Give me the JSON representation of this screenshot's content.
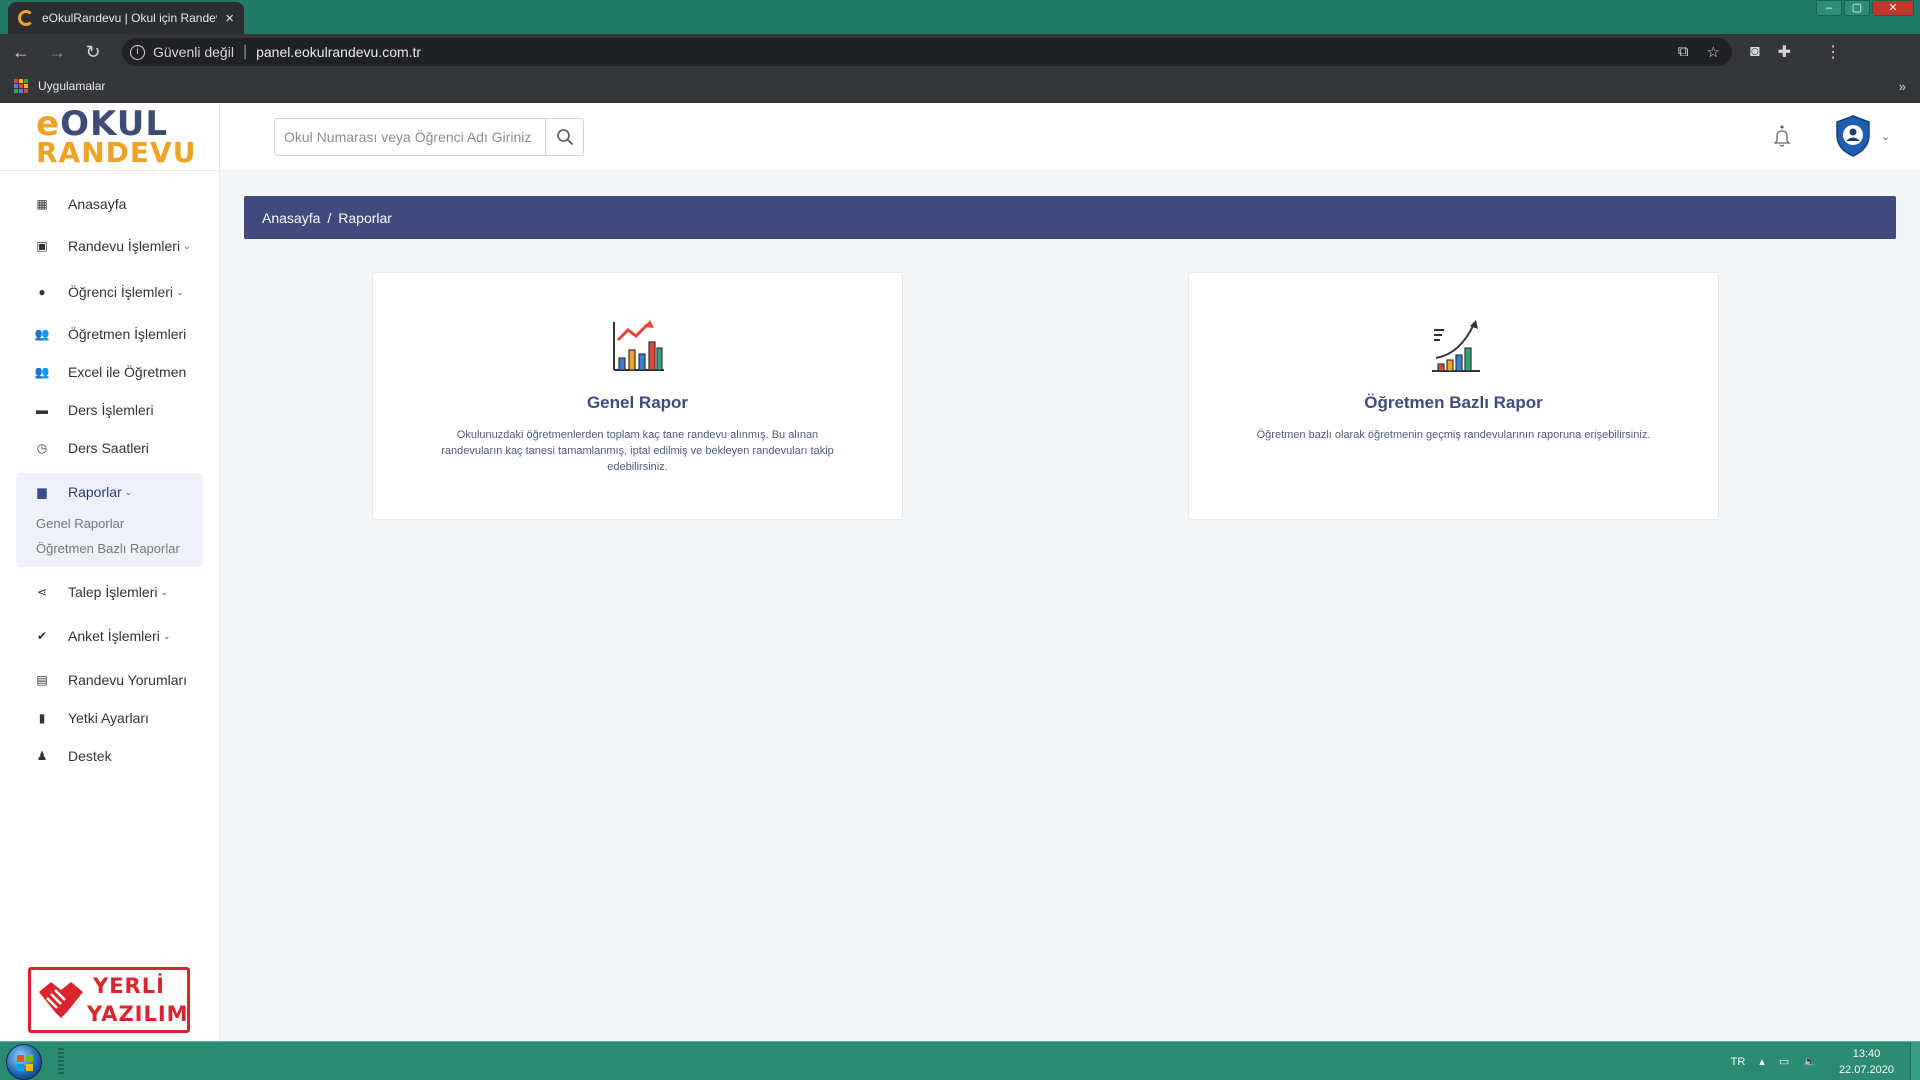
{
  "browser": {
    "tab_title": "eOkulRandevu | Okul için Randevu",
    "security_label": "Güvenli değil",
    "url": "panel.eokulrandevu.com.tr",
    "bookmarks_label": "Uygulamalar",
    "bookmarks_more": "»"
  },
  "logo": {
    "line1_accent": "e",
    "line1": "OKUL",
    "line2": "RANDEVU"
  },
  "search": {
    "placeholder": "Okul Numarası veya Öğrenci Adı Giriniz"
  },
  "sidebar": {
    "items": [
      {
        "label": "Anasayfa",
        "icon": "dashboard-icon"
      },
      {
        "label": "Randevu İşlemleri",
        "icon": "calendar-icon",
        "chevron": true
      },
      {
        "label": "Öğrenci İşlemleri",
        "icon": "user-icon",
        "chevron": true
      },
      {
        "label": "Öğretmen İşlemleri",
        "icon": "users-icon"
      },
      {
        "label": "Excel ile Öğretmen",
        "icon": "users-icon"
      },
      {
        "label": "Ders İşlemleri",
        "icon": "folder-icon"
      },
      {
        "label": "Ders Saatleri",
        "icon": "clock-icon"
      },
      {
        "label": "Raporlar",
        "icon": "bar-chart-icon",
        "chevron": true,
        "active": true
      },
      {
        "label": "Talep İşlemleri",
        "icon": "share-icon",
        "chevron": true
      },
      {
        "label": "Anket İşlemleri",
        "icon": "check-circle-icon",
        "chevron": true
      },
      {
        "label": "Randevu Yorumları",
        "icon": "comment-icon"
      },
      {
        "label": "Yetki Ayarları",
        "icon": "lock-icon"
      },
      {
        "label": "Destek",
        "icon": "support-icon"
      }
    ],
    "raporlar_sub": [
      "Genel Raporlar",
      "Öğretmen Bazlı Raporlar"
    ],
    "chevron_glyph": "⌄"
  },
  "brand_badge": {
    "line1": "YERLİ",
    "line2": "YAZILIM"
  },
  "breadcrumb": {
    "home": "Anasayfa",
    "separator": "/",
    "current": "Raporlar"
  },
  "cards": [
    {
      "title": "Genel Rapor",
      "icon": "growth-chart-icon",
      "description": "Okulunuzdaki öğretmenlerden toplam kaç tane randevu alınmış. Bu alınan randevuların kaç tanesi tamamlanmış, iptal edilmiş ve bekleyen randevuları takip edebilirsiniz."
    },
    {
      "title": "Öğretmen Bazlı Rapor",
      "icon": "teacher-chart-icon",
      "description": "Öğretmen bazlı olarak öğretmenin geçmiş randevularının raporuna erişebilirsiniz."
    }
  ],
  "taskbar": {
    "language": "TR",
    "time": "13:40",
    "date": "22.07.2020"
  },
  "colors": {
    "primary": "#3f4a7d",
    "accent": "#f0a224",
    "brand_red": "#d9262e",
    "taskbar": "#2c8a72"
  }
}
